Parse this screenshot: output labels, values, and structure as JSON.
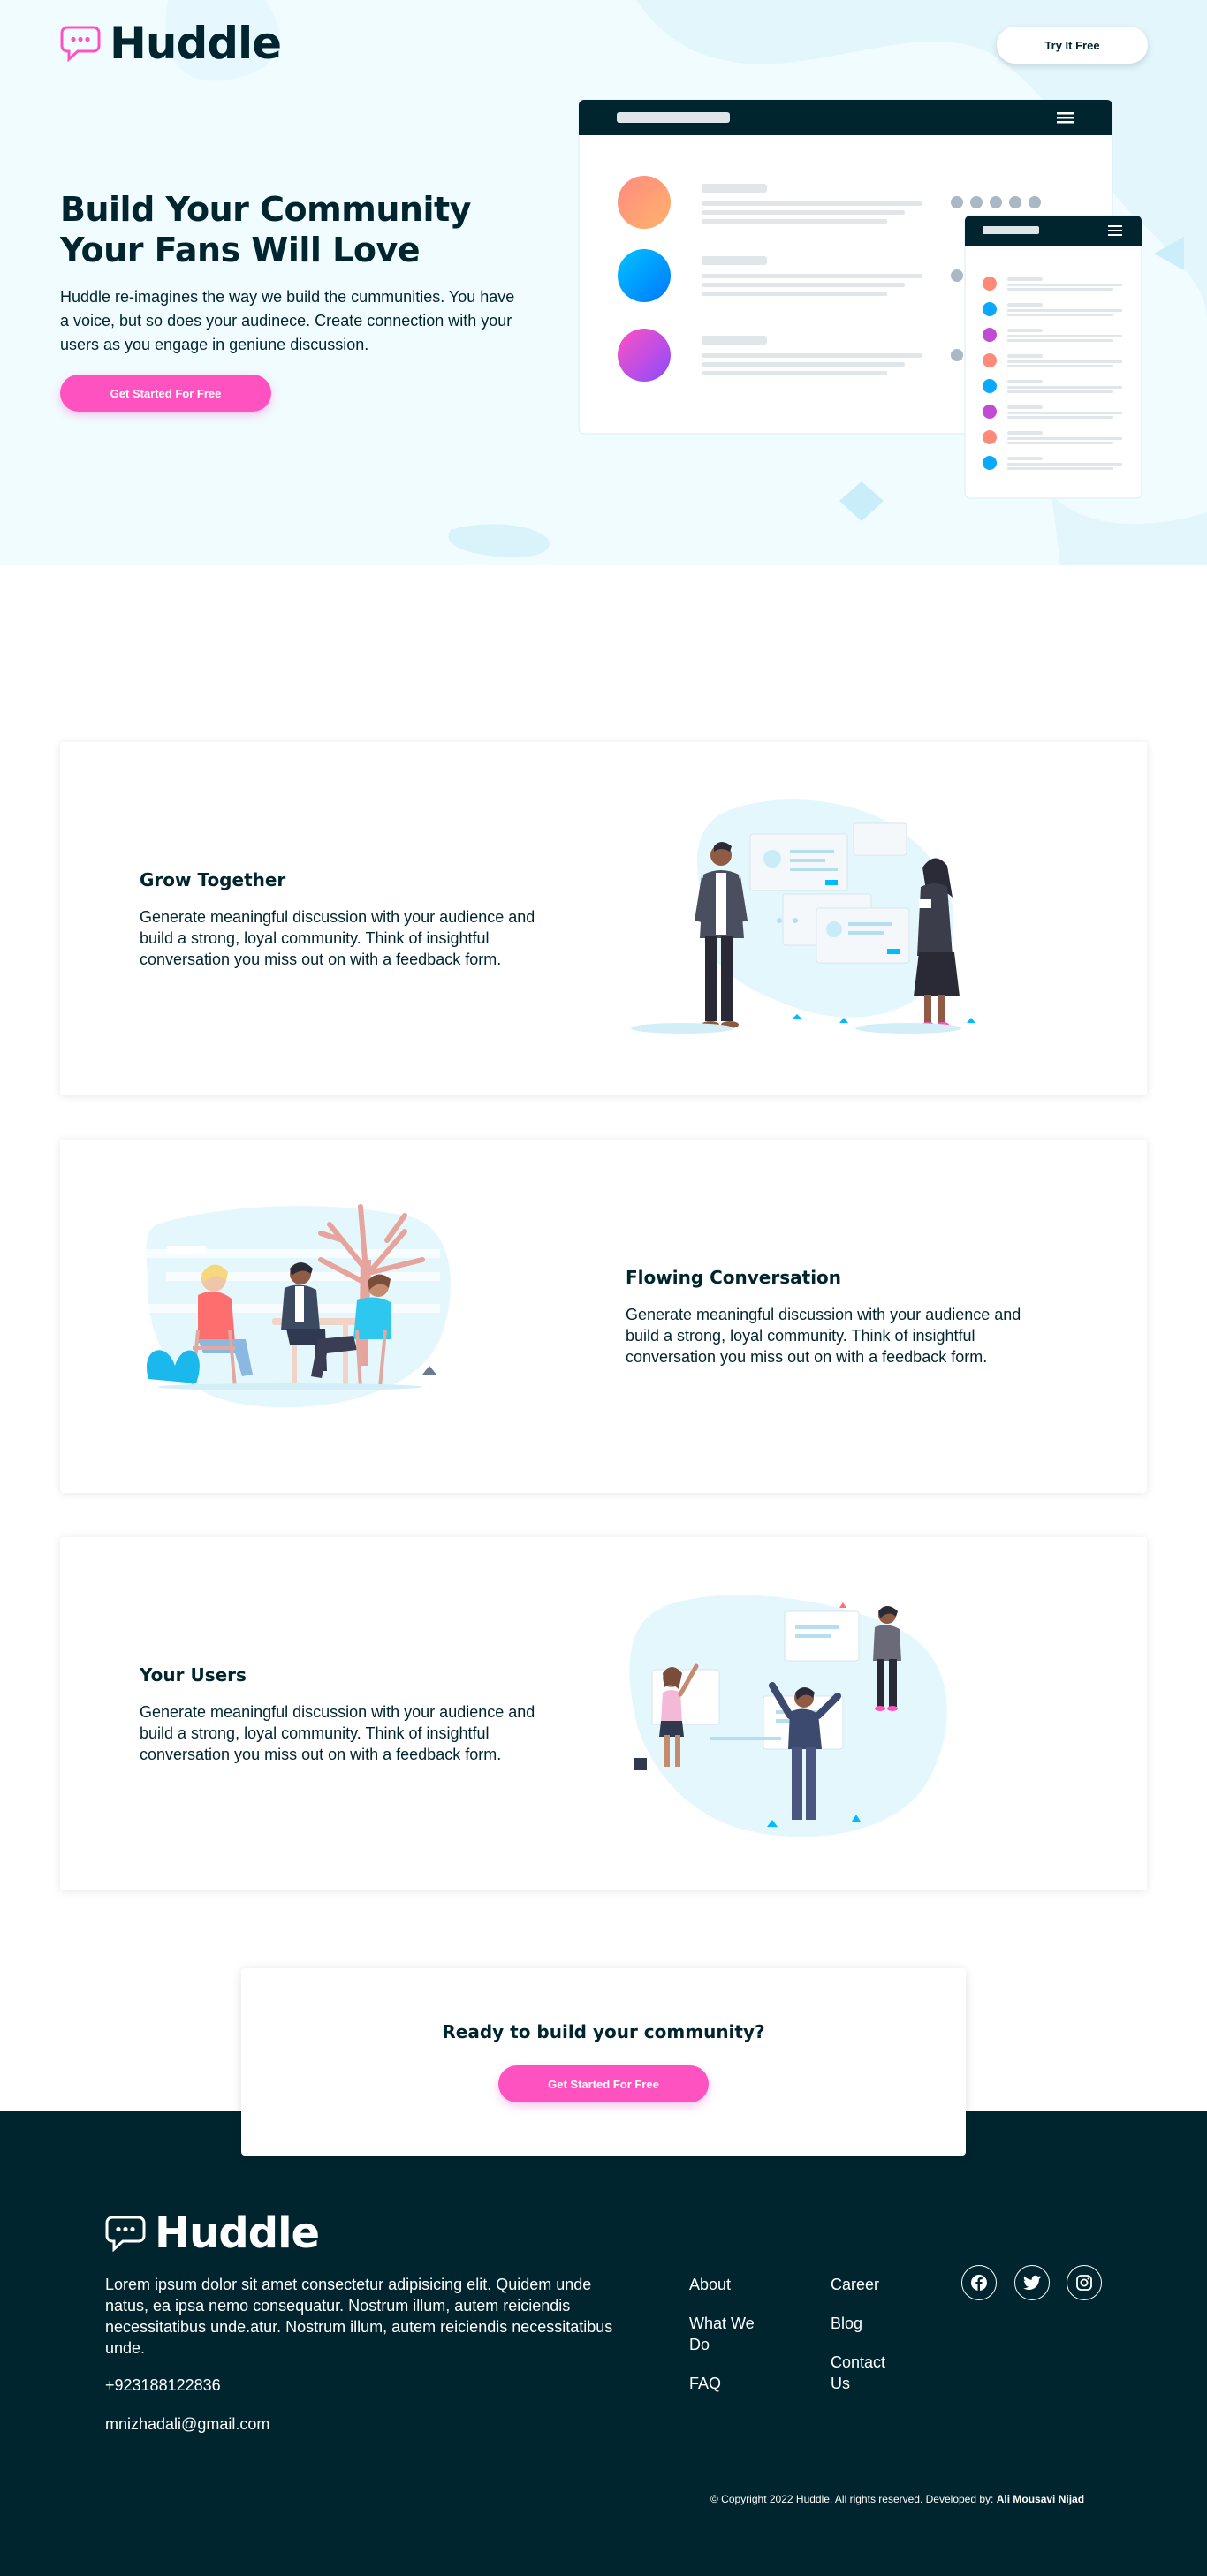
{
  "brand": {
    "name": "Huddle"
  },
  "header": {
    "cta_label": "Try It Free"
  },
  "hero": {
    "title": "Build Your Community Your Fans Will Love",
    "description": "Huddle re-imagines the way we build the cummunities. You have a voice, but so does your audinece. Create connection with your users as you engage in geniune discussion.",
    "cta_label": "Get Started For Free"
  },
  "features": [
    {
      "title": "Grow Together",
      "text": "Generate meaningful discussion with your audience and build a strong, loyal community. Think of insightful conversation you miss out on with a feedback form."
    },
    {
      "title": "Flowing Conversation",
      "text": "Generate meaningful discussion with your audience and build a strong, loyal community. Think of insightful conversation you miss out on with a feedback form."
    },
    {
      "title": "Your Users",
      "text": "Generate meaningful discussion with your audience and build a strong, loyal community. Think of insightful conversation you miss out on with a feedback form."
    }
  ],
  "cta": {
    "title": "Ready to build your community?",
    "button_label": "Get Started For Free"
  },
  "footer": {
    "brand": "Huddle",
    "description": "Lorem ipsum dolor sit amet consectetur adipisicing elit. Quidem unde natus, ea ipsa nemo consequatur. Nostrum illum, autem reiciendis necessitatibus unde.atur. Nostrum illum, autem reiciendis necessitatibus unde.",
    "phone": "+923188122836",
    "email": "mnizhadali@gmail.com",
    "links_col1": [
      "About",
      "What We Do",
      "FAQ"
    ],
    "links_col2": [
      "Career",
      "Blog",
      "Contact Us"
    ],
    "social": [
      "facebook-icon",
      "twitter-icon",
      "instagram-icon"
    ],
    "copyright_prefix": "© Copyright 2022 Huddle. All rights reserved. Developed by:",
    "copyright_author": "Ali Mousavi Nijad"
  },
  "colors": {
    "navy": "#00252e",
    "pink": "#ff52c1",
    "hero_bg": "#f0fcff",
    "cyan": "#00bbff"
  }
}
